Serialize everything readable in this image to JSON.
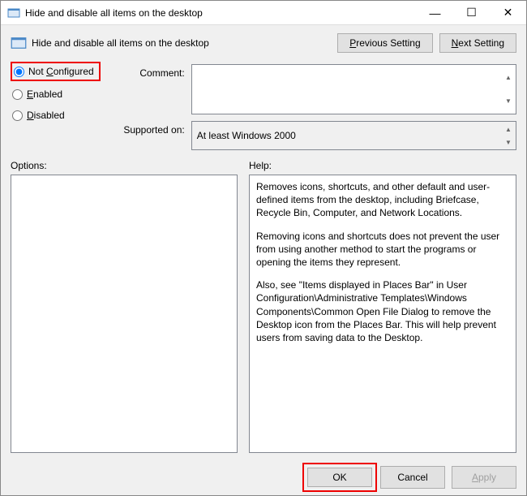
{
  "window": {
    "title": "Hide and disable all items on the desktop"
  },
  "header": {
    "policy_name": "Hide and disable all items on the desktop",
    "prev_plain": "Previous Setting",
    "next_plain": "Next Setting"
  },
  "state": {
    "not_configured": "Not Configured",
    "enabled": "Enabled",
    "disabled": "Disabled"
  },
  "fields": {
    "comment_label": "Comment:",
    "comment_value": "",
    "supported_label": "Supported on:",
    "supported_value": "At least Windows 2000"
  },
  "lower": {
    "options_label": "Options:",
    "help_label": "Help:"
  },
  "help": {
    "p1": "Removes icons, shortcuts, and other default and user-defined items from the desktop, including Briefcase, Recycle Bin, Computer, and Network Locations.",
    "p2": "Removing icons and shortcuts does not prevent the user from using another method to start the programs or opening the items they represent.",
    "p3": "Also, see \"Items displayed in Places Bar\" in User Configuration\\Administrative Templates\\Windows Components\\Common Open File Dialog to remove the Desktop icon from the Places Bar. This will help prevent users from saving data to the Desktop."
  },
  "footer": {
    "ok": "OK",
    "cancel": "Cancel",
    "apply": "Apply"
  }
}
